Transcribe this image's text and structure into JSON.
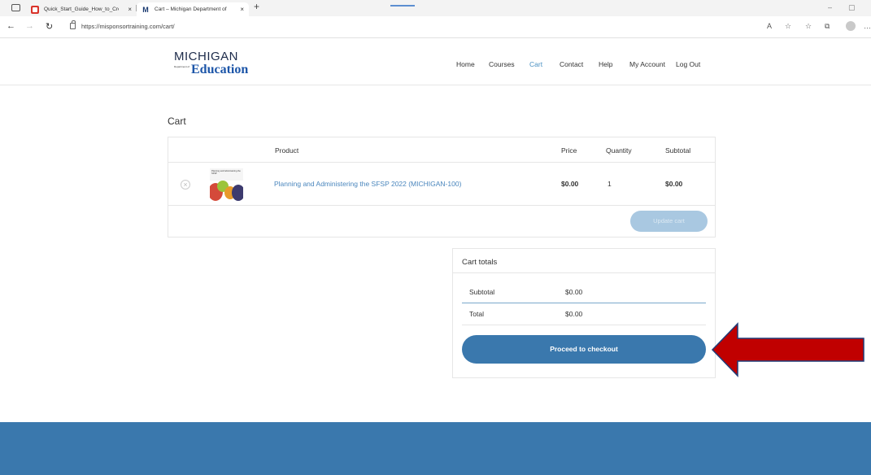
{
  "browser": {
    "tabs": [
      {
        "title": "Quick_Start_Guide_How_to_Cre",
        "icon": "pdf-icon"
      },
      {
        "title": "Cart – Michigan Department of",
        "icon": "michigan-m-icon"
      }
    ],
    "close_glyph": "×",
    "new_tab_glyph": "+",
    "url": "https://misponsortraining.com/cart/"
  },
  "logo": {
    "top": "MICHIGAN",
    "dept": "Department of",
    "bottom": "Education"
  },
  "nav": {
    "items": [
      "Home",
      "Courses",
      "Cart",
      "Contact",
      "Help",
      "My Account",
      "Log Out"
    ],
    "active": "Cart"
  },
  "cart": {
    "title": "Cart",
    "headers": {
      "product": "Product",
      "price": "Price",
      "quantity": "Quantity",
      "subtotal": "Subtotal"
    },
    "items": [
      {
        "thumbnail_caption": "Planning and Administering the SFSP",
        "name": "Planning and Administering the SFSP 2022 (MICHIGAN-100)",
        "price": "$0.00",
        "quantity": "1",
        "subtotal": "$0.00"
      }
    ],
    "update_label": "Update cart"
  },
  "totals": {
    "title": "Cart totals",
    "subtotal_label": "Subtotal",
    "subtotal_value": "$0.00",
    "total_label": "Total",
    "total_value": "$0.00",
    "checkout_label": "Proceed to checkout"
  },
  "colors": {
    "accent": "#3a78ad",
    "link": "#4a86bd",
    "arrow": "#c00000",
    "arrow_outline": "#1f3c78"
  }
}
